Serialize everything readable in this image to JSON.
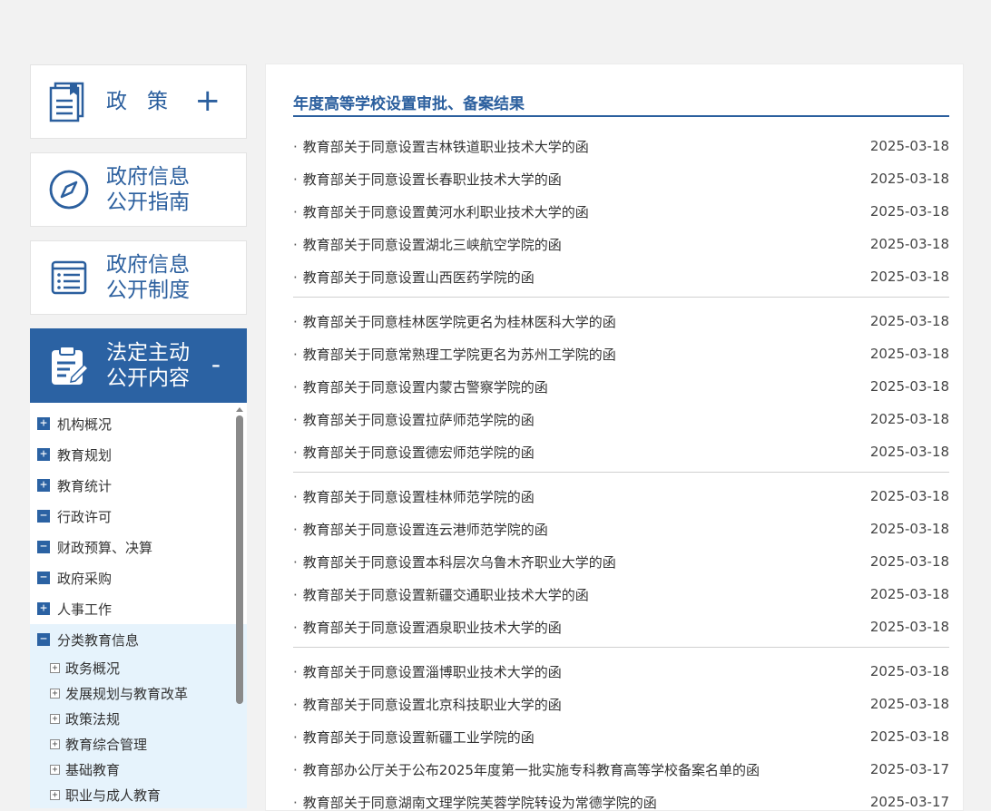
{
  "sidebar": {
    "cards": [
      {
        "title": "政策",
        "toggle": "+"
      },
      {
        "title_line1": "政府信息",
        "title_line2": "公开指南"
      },
      {
        "title_line1": "政府信息",
        "title_line2": "公开制度"
      },
      {
        "title_line1": "法定主动",
        "title_line2": "公开内容",
        "toggle": "-"
      }
    ],
    "tree": [
      {
        "label": "机构概况",
        "sign": "+"
      },
      {
        "label": "教育规划",
        "sign": "+"
      },
      {
        "label": "教育统计",
        "sign": "+"
      },
      {
        "label": "行政许可",
        "sign": "−"
      },
      {
        "label": "财政预算、决算",
        "sign": "−"
      },
      {
        "label": "政府采购",
        "sign": "−"
      },
      {
        "label": "人事工作",
        "sign": "+"
      },
      {
        "label": "分类教育信息",
        "sign": "−"
      }
    ],
    "subtree": [
      {
        "label": "政务概况",
        "sign": "+"
      },
      {
        "label": "发展规划与教育改革",
        "sign": "+"
      },
      {
        "label": "政策法规",
        "sign": "+"
      },
      {
        "label": "教育综合管理",
        "sign": "+"
      },
      {
        "label": "基础教育",
        "sign": "+"
      },
      {
        "label": "职业与成人教育",
        "sign": "+"
      }
    ]
  },
  "main": {
    "title": "年度高等学校设置审批、备案结果",
    "groups": [
      [
        {
          "title": "教育部关于同意设置吉林铁道职业技术大学的函",
          "date": "2025-03-18"
        },
        {
          "title": "教育部关于同意设置长春职业技术大学的函",
          "date": "2025-03-18"
        },
        {
          "title": "教育部关于同意设置黄河水利职业技术大学的函",
          "date": "2025-03-18"
        },
        {
          "title": "教育部关于同意设置湖北三峡航空学院的函",
          "date": "2025-03-18"
        },
        {
          "title": "教育部关于同意设置山西医药学院的函",
          "date": "2025-03-18"
        }
      ],
      [
        {
          "title": "教育部关于同意桂林医学院更名为桂林医科大学的函",
          "date": "2025-03-18"
        },
        {
          "title": "教育部关于同意常熟理工学院更名为苏州工学院的函",
          "date": "2025-03-18"
        },
        {
          "title": "教育部关于同意设置内蒙古警察学院的函",
          "date": "2025-03-18"
        },
        {
          "title": "教育部关于同意设置拉萨师范学院的函",
          "date": "2025-03-18"
        },
        {
          "title": "教育部关于同意设置德宏师范学院的函",
          "date": "2025-03-18"
        }
      ],
      [
        {
          "title": "教育部关于同意设置桂林师范学院的函",
          "date": "2025-03-18"
        },
        {
          "title": "教育部关于同意设置连云港师范学院的函",
          "date": "2025-03-18"
        },
        {
          "title": "教育部关于同意设置本科层次乌鲁木齐职业大学的函",
          "date": "2025-03-18"
        },
        {
          "title": "教育部关于同意设置新疆交通职业技术大学的函",
          "date": "2025-03-18"
        },
        {
          "title": "教育部关于同意设置酒泉职业技术大学的函",
          "date": "2025-03-18"
        }
      ],
      [
        {
          "title": "教育部关于同意设置淄博职业技术大学的函",
          "date": "2025-03-18"
        },
        {
          "title": "教育部关于同意设置北京科技职业大学的函",
          "date": "2025-03-18"
        },
        {
          "title": "教育部关于同意设置新疆工业学院的函",
          "date": "2025-03-18"
        },
        {
          "title": "教育部办公厅关于公布2025年度第一批实施专科教育高等学校备案名单的函",
          "date": "2025-03-17"
        },
        {
          "title": "教育部关于同意湖南文理学院芙蓉学院转设为常德学院的函",
          "date": "2025-03-17"
        }
      ]
    ]
  },
  "colors": {
    "brand": "#2b62a3",
    "title": "#2b5f9e",
    "tree_active": "#e6f3fc"
  },
  "icons": [
    "book-icon",
    "compass-icon",
    "document-list-icon",
    "clipboard-edit-icon"
  ]
}
